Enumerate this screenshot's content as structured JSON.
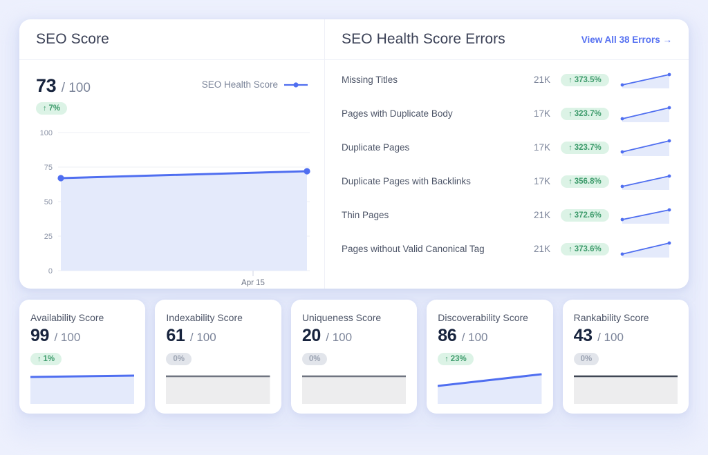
{
  "seo_score_panel": {
    "title": "SEO Score",
    "score": "73",
    "denominator": "/ 100",
    "change_badge": {
      "arrow": "↑",
      "value": "7%",
      "trend": "up"
    },
    "legend": {
      "label": "SEO Health Score",
      "color": "#4f6ef0"
    }
  },
  "errors_panel": {
    "title": "SEO Health Score Errors",
    "view_all_label": "View All 38 Errors →",
    "rows": [
      {
        "name": "Missing Titles",
        "count": "21K",
        "arrow": "↑",
        "change": "373.5%"
      },
      {
        "name": "Pages with Duplicate Body",
        "count": "17K",
        "arrow": "↑",
        "change": "323.7%"
      },
      {
        "name": "Duplicate Pages",
        "count": "17K",
        "arrow": "↑",
        "change": "323.7%"
      },
      {
        "name": "Duplicate Pages with Backlinks",
        "count": "17K",
        "arrow": "↑",
        "change": "356.8%"
      },
      {
        "name": "Thin Pages",
        "count": "21K",
        "arrow": "↑",
        "change": "372.6%"
      },
      {
        "name": "Pages without Valid Canonical Tag",
        "count": "21K",
        "arrow": "↑",
        "change": "373.6%"
      }
    ]
  },
  "score_cards": [
    {
      "title": "Availability Score",
      "score": "99",
      "denominator": "/ 100",
      "arrow": "↑",
      "change": "1%",
      "trend": "up"
    },
    {
      "title": "Indexability Score",
      "score": "61",
      "denominator": "/ 100",
      "arrow": "",
      "change": "0%",
      "trend": "flat"
    },
    {
      "title": "Uniqueness Score",
      "score": "20",
      "denominator": "/ 100",
      "arrow": "",
      "change": "0%",
      "trend": "flat"
    },
    {
      "title": "Discoverability Score",
      "score": "86",
      "denominator": "/ 100",
      "arrow": "↑",
      "change": "23%",
      "trend": "up"
    },
    {
      "title": "Rankability Score",
      "score": "43",
      "denominator": "/ 100",
      "arrow": "",
      "change": "0%",
      "trend": "flat"
    }
  ],
  "colors": {
    "accent_blue": "#4f6ef0",
    "area_fill": "#e4eafb",
    "green_badge_bg": "#dcf3e6",
    "green_badge_text": "#3d9b6b",
    "gray_badge_bg": "#e2e5eb",
    "gray_badge_text": "#9aa2b1",
    "gray_line": "#6f7480",
    "gray_fill": "#ededee",
    "page_bg": "#edf0fd"
  },
  "chart_data": {
    "type": "area",
    "title": "SEO Health Score",
    "xlabel": "",
    "ylabel": "",
    "ylim": [
      0,
      100
    ],
    "yticks": [
      0,
      25,
      50,
      75,
      100
    ],
    "ytick_labels": [
      "0",
      "25",
      "50",
      "75",
      "100"
    ],
    "xtick_labels": [
      "Apr 15"
    ],
    "grid": true,
    "legend_position": "top-right",
    "series": [
      {
        "name": "SEO Health Score",
        "x": [
          "",
          "Apr 15"
        ],
        "values": [
          67,
          72
        ],
        "color": "#4f6ef0"
      }
    ],
    "sparklines": [
      {
        "name": "Missing Titles",
        "values": [
          10,
          85
        ],
        "color": "#4f6ef0"
      },
      {
        "name": "Pages with Duplicate Body",
        "values": [
          12,
          88
        ],
        "color": "#4f6ef0"
      },
      {
        "name": "Duplicate Pages",
        "values": [
          15,
          90
        ],
        "color": "#4f6ef0"
      },
      {
        "name": "Duplicate Pages with Backlinks",
        "values": [
          10,
          86
        ],
        "color": "#4f6ef0"
      },
      {
        "name": "Thin Pages",
        "values": [
          14,
          84
        ],
        "color": "#4f6ef0"
      },
      {
        "name": "Pages without Valid Canonical Tag",
        "values": [
          12,
          88
        ],
        "color": "#4f6ef0"
      }
    ],
    "card_charts": [
      {
        "name": "Availability Score",
        "values": [
          96,
          99
        ],
        "color": "#4f6ef0",
        "fill": "#e4eafb"
      },
      {
        "name": "Indexability Score",
        "values": [
          61,
          61
        ],
        "color": "#6f7480",
        "fill": "#ededee"
      },
      {
        "name": "Uniqueness Score",
        "values": [
          20,
          20
        ],
        "color": "#6f7480",
        "fill": "#ededee"
      },
      {
        "name": "Discoverability Score",
        "values": [
          63,
          86
        ],
        "color": "#4f6ef0",
        "fill": "#e4eafb"
      },
      {
        "name": "Rankability Score",
        "values": [
          43,
          43
        ],
        "color": "#6f7480",
        "fill": "#ededee"
      }
    ]
  }
}
